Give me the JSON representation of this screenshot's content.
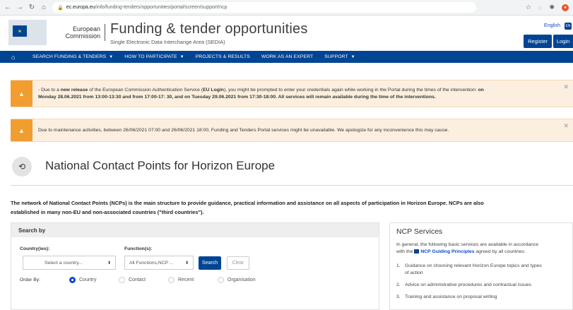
{
  "browser": {
    "url_host": "ec.europa.eu",
    "url_path": "/info/funding-tenders/opportunities/portal/screen/support/ncp"
  },
  "header": {
    "org_line1": "European",
    "org_line2": "Commission",
    "title": "Funding & tender opportunities",
    "subtitle": "Single Electronic Data Interchange Area (SEDIA)",
    "language": "English",
    "language_code": "EN",
    "register_label": "Register",
    "login_label": "Login"
  },
  "nav": {
    "items": [
      {
        "label": "SEARCH FUNDING & TENDERS",
        "caret": true
      },
      {
        "label": "HOW TO PARTICIPATE",
        "caret": true
      },
      {
        "label": "PROJECTS & RESULTS",
        "caret": false
      },
      {
        "label": "WORK AS AN EXPERT",
        "caret": false
      },
      {
        "label": "SUPPORT",
        "caret": true
      }
    ]
  },
  "alerts": {
    "first": {
      "prefix": "- Due to a ",
      "bold1": "new release",
      "mid1": " of the European Commission Authentication Service (",
      "bold2": "EU Login",
      "mid2": "), you might be prompted to enter your credentials again while working in the Portal during the times of the intervention: ",
      "bold3": "on",
      "line2": "Monday 28.06.2021 from 13:00-13:30 and from 17:00-17: 30, and on Tuesday 29.06.2021 from 17:30-18:00. All services will remain available during the time of the interventions."
    },
    "second": {
      "text": "Due to maintenance activities, between 26/06/2021 07:00 and 26/06/2021 18:00, Funding and Tenders Portal services might be unavailable. We apologize for any inconvenience this may cause."
    }
  },
  "page": {
    "title": "National Contact Points for Horizon Europe",
    "intro_line1": "The network of National Contact Points (NCPs) is the main structure to provide guidance, practical information and assistance on all aspects of participation in Horizon Europe. NCPs are also",
    "intro_line2": "established in many non-EU and non-associated countries (\"third countries\")."
  },
  "search": {
    "header": "Search by",
    "country_label": "Country(ies):",
    "country_value": "Select a country...",
    "function_label": "Function(s):",
    "function_value": "All Functions,NCP ...",
    "search_label": "Search",
    "clear_label": "Clear",
    "order_label": "Order By:",
    "order_options": [
      "Country",
      "Contact",
      "Recent",
      "Organisation"
    ],
    "order_selected": "Country"
  },
  "services": {
    "title": "NCP Services",
    "desc_line1": "In general, the following basic services are available in accordance",
    "desc_prefix": "with the ",
    "desc_link": "NCP Guiding Principles",
    "desc_suffix": " agreed by all countries:",
    "items": [
      {
        "n": "1.",
        "line1": "Guidance on choosing relevant Horizon Europe topics and types",
        "line2": "of action"
      },
      {
        "n": "2.",
        "line1": "Advice on administrative procedures and contractual issues",
        "line2": ""
      },
      {
        "n": "3.",
        "line1": "Training and assistance on proposal writing",
        "line2": ""
      }
    ]
  }
}
